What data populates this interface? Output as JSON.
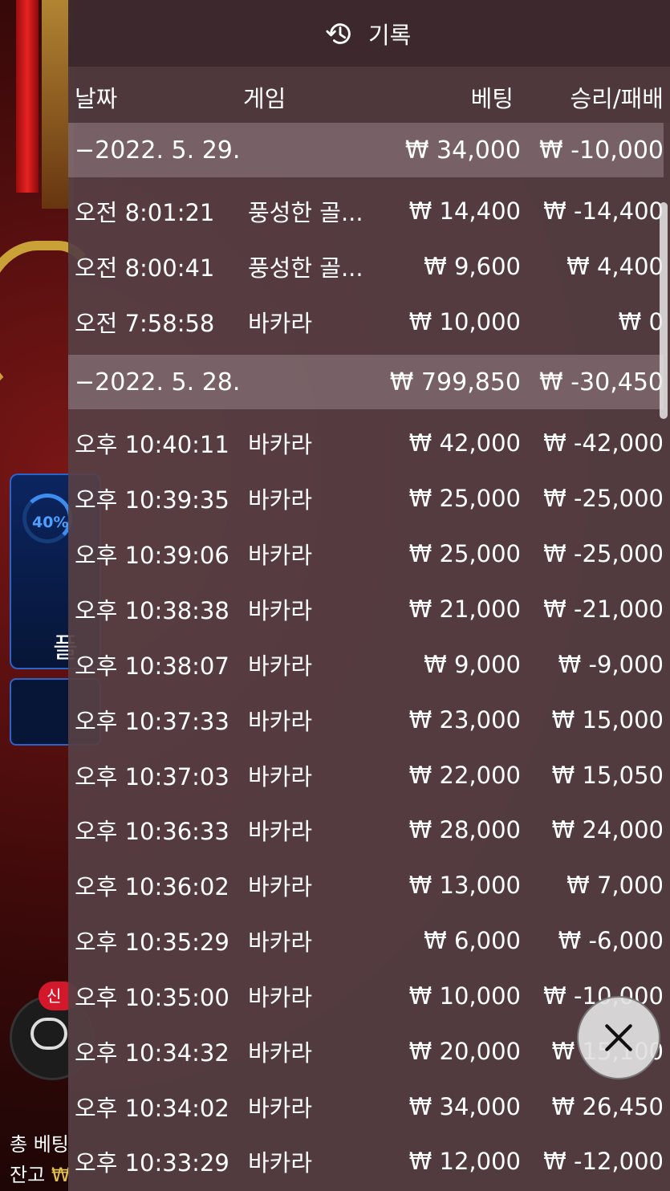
{
  "header": {
    "title": "기록",
    "icon": "history-icon"
  },
  "columns": {
    "date": "날짜",
    "game": "게임",
    "bet": "베팅",
    "win_loss": "승리/패배"
  },
  "groups": [
    {
      "date": "−2022. 5. 29.",
      "bet": "₩ 34,000",
      "win_loss": "₩ -10,000",
      "rows": [
        {
          "time": "오전 8:01:21",
          "game": "풍성한 골...",
          "bet": "₩ 14,400",
          "win_loss": "₩ -14,400"
        },
        {
          "time": "오전 8:00:41",
          "game": "풍성한 골...",
          "bet": "₩ 9,600",
          "win_loss": "₩ 4,400"
        },
        {
          "time": "오전 7:58:58",
          "game": "바카라",
          "bet": "₩ 10,000",
          "win_loss": "₩ 0"
        }
      ]
    },
    {
      "date": "−2022. 5. 28.",
      "bet": "₩ 799,850",
      "win_loss": "₩ -30,450",
      "rows": [
        {
          "time": "오후 10:40:11",
          "game": "바카라",
          "bet": "₩ 42,000",
          "win_loss": "₩ -42,000"
        },
        {
          "time": "오후 10:39:35",
          "game": "바카라",
          "bet": "₩ 25,000",
          "win_loss": "₩ -25,000"
        },
        {
          "time": "오후 10:39:06",
          "game": "바카라",
          "bet": "₩ 25,000",
          "win_loss": "₩ -25,000"
        },
        {
          "time": "오후 10:38:38",
          "game": "바카라",
          "bet": "₩ 21,000",
          "win_loss": "₩ -21,000"
        },
        {
          "time": "오후 10:38:07",
          "game": "바카라",
          "bet": "₩ 9,000",
          "win_loss": "₩ -9,000"
        },
        {
          "time": "오후 10:37:33",
          "game": "바카라",
          "bet": "₩ 23,000",
          "win_loss": "₩ 15,000"
        },
        {
          "time": "오후 10:37:03",
          "game": "바카라",
          "bet": "₩ 22,000",
          "win_loss": "₩ 15,050"
        },
        {
          "time": "오후 10:36:33",
          "game": "바카라",
          "bet": "₩ 28,000",
          "win_loss": "₩ 24,000"
        },
        {
          "time": "오후 10:36:02",
          "game": "바카라",
          "bet": "₩ 13,000",
          "win_loss": "₩ 7,000"
        },
        {
          "time": "오후 10:35:29",
          "game": "바카라",
          "bet": "₩ 6,000",
          "win_loss": "₩ -6,000"
        },
        {
          "time": "오후 10:35:00",
          "game": "바카라",
          "bet": "₩ 10,000",
          "win_loss": "₩ -10,000"
        },
        {
          "time": "오후 10:34:32",
          "game": "바카라",
          "bet": "₩ 20,000",
          "win_loss": "₩ 15,100"
        },
        {
          "time": "오후 10:34:02",
          "game": "바카라",
          "bet": "₩ 34,000",
          "win_loss": "₩ 26,450"
        },
        {
          "time": "오후 10:33:29",
          "game": "바카라",
          "bet": "₩ 12,000",
          "win_loss": "₩ -12,000"
        }
      ]
    }
  ],
  "background": {
    "progress_label": "40%",
    "bet_card_char": "플",
    "new_badge": "신",
    "total_bet_label": "총 베팅",
    "balance_label": "잔고",
    "coin_symbol": "₩"
  },
  "close_icon": "close-icon",
  "colors": {
    "panel_bg": "#564044",
    "group_bg": "#968286",
    "text": "#ffffff",
    "accent_blue": "#3b8df0",
    "badge_red": "#d3182c"
  }
}
